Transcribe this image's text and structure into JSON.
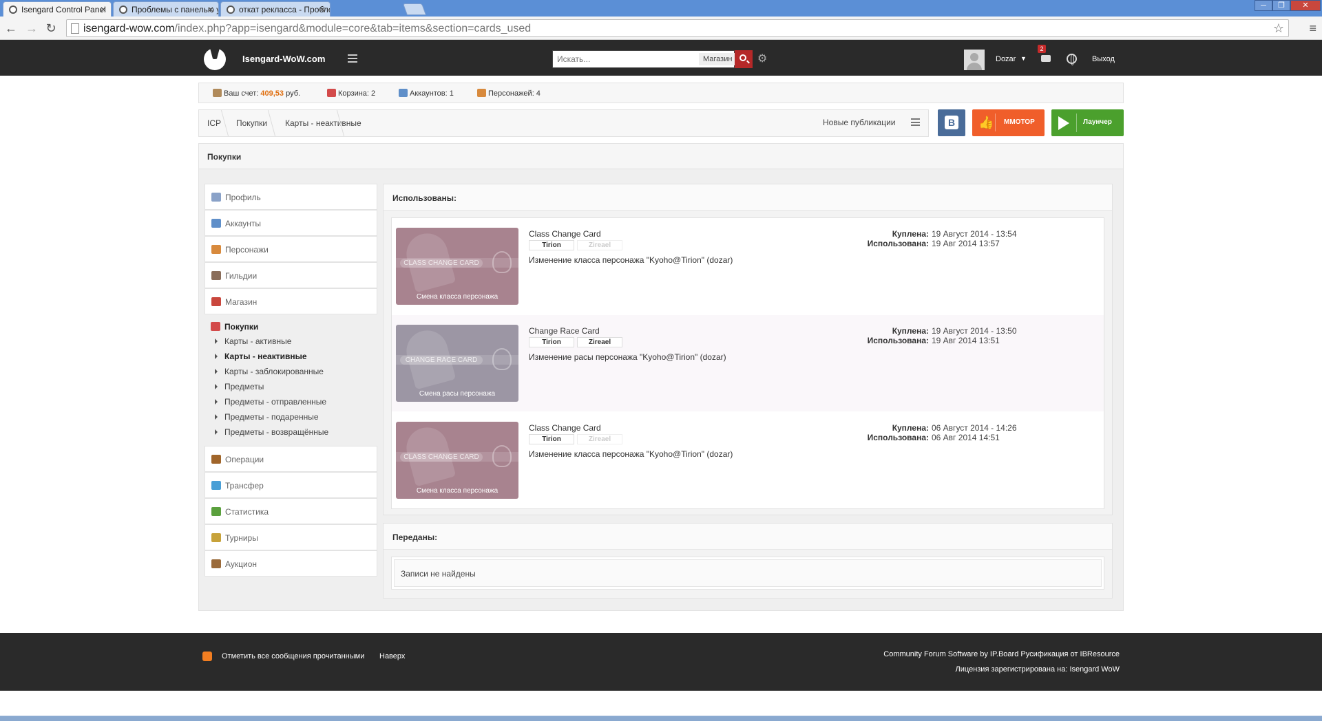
{
  "browser": {
    "tabs": [
      {
        "title": "Isengard Control Panel",
        "active": true
      },
      {
        "title": "Проблемы с панелью уп",
        "active": false
      },
      {
        "title": "откат рекласса - Пробле",
        "active": false
      }
    ],
    "url_host": "isengard-wow.com",
    "url_path": "/index.php?app=isengard&module=core&tab=items&section=cards_used",
    "window_controls": [
      "─",
      "❐",
      "✕"
    ]
  },
  "header": {
    "brand": "Isengard-WoW.com",
    "search_placeholder": "Искать...",
    "search_scope": "Магазин",
    "username": "Dozar",
    "notification_count": "2",
    "logout": "Выход"
  },
  "infobar": {
    "balance_label": "Ваш счет:",
    "balance_value": "409,53",
    "balance_unit": "руб.",
    "cart": "Корзина: 2",
    "accounts": "Аккаунтов: 1",
    "characters": "Персонажей: 4"
  },
  "breadcrumb": {
    "items": [
      "ICP",
      "Покупки",
      "Карты - неактивные"
    ],
    "new_publications": "Новые публикации"
  },
  "social": {
    "vk": "В",
    "mmotop": "ММОТОР",
    "launcher": "Лаунчер"
  },
  "page": {
    "title": "Покупки"
  },
  "sidebar": {
    "top_items": [
      {
        "label": "Профиль",
        "icon": "profile-icon",
        "color": "#8aa2c8"
      },
      {
        "label": "Аккаунты",
        "icon": "accounts-icon",
        "color": "#5f8fc9"
      },
      {
        "label": "Персонажи",
        "icon": "characters-icon",
        "color": "#d88a3d"
      },
      {
        "label": "Гильдии",
        "icon": "guilds-icon",
        "color": "#8a6d5a"
      },
      {
        "label": "Магазин",
        "icon": "shop-icon",
        "color": "#c9473d"
      }
    ],
    "purchases": {
      "label": "Покупки",
      "subitems": [
        {
          "label": "Карты - активные",
          "active": false
        },
        {
          "label": "Карты - неактивные",
          "active": true
        },
        {
          "label": "Карты - заблокированные",
          "active": false
        },
        {
          "label": "Предметы",
          "active": false
        },
        {
          "label": "Предметы - отправленные",
          "active": false
        },
        {
          "label": "Предметы - подаренные",
          "active": false
        },
        {
          "label": "Предметы - возвращённые",
          "active": false
        }
      ]
    },
    "bottom_items": [
      {
        "label": "Операции",
        "icon": "operations-icon",
        "color": "#a0652a"
      },
      {
        "label": "Трансфер",
        "icon": "transfer-icon",
        "color": "#4a9fd6"
      },
      {
        "label": "Статистика",
        "icon": "statistics-icon",
        "color": "#5aa03d"
      },
      {
        "label": "Турниры",
        "icon": "tournaments-icon",
        "color": "#c7a23a"
      },
      {
        "label": "Аукцион",
        "icon": "auction-icon",
        "color": "#9a6a3a"
      }
    ]
  },
  "used": {
    "heading": "Использованы:",
    "bought_label": "Куплена:",
    "used_label": "Использована:",
    "cards": [
      {
        "name": "Class Change Card",
        "realm": "Tirion",
        "character": "Zireael",
        "character_active": false,
        "description": "Изменение класса персонажа \"Kyoho@Tirion\" (dozar)",
        "card_title": "CLASS CHANGE CARD",
        "card_caption": "Смена класса персонажа",
        "card_color": "#a8838f",
        "bought": "19 Август 2014 - 13:54",
        "used": "19 Авг 2014 13:57"
      },
      {
        "name": "Change Race Card",
        "realm": "Tirion",
        "character": "Zireael",
        "character_active": true,
        "description": "Изменение расы персонажа \"Kyoho@Tirion\" (dozar)",
        "card_title": "CHANGE RACE CARD",
        "card_caption": "Смена расы персонажа",
        "card_color": "#9c96a4",
        "bought": "19 Август 2014 - 13:50",
        "used": "19 Авг 2014 13:51"
      },
      {
        "name": "Class Change Card",
        "realm": "Tirion",
        "character": "Zireael",
        "character_active": false,
        "description": "Изменение класса персонажа \"Kyoho@Tirion\" (dozar)",
        "card_title": "CLASS CHANGE CARD",
        "card_caption": "Смена класса персонажа",
        "card_color": "#a8838f",
        "bought": "06 Август 2014 - 14:26",
        "used": "06 Авг 2014 14:51"
      }
    ]
  },
  "transferred": {
    "heading": "Переданы:",
    "empty": "Записи не найдены"
  },
  "footer": {
    "mark_read": "Отметить все сообщения прочитанными",
    "to_top": "Наверх",
    "credits": "Community Forum Software by IP.Board Русификация от IBResource",
    "license": "Лицензия зарегистрирована на: Isengard WoW"
  }
}
